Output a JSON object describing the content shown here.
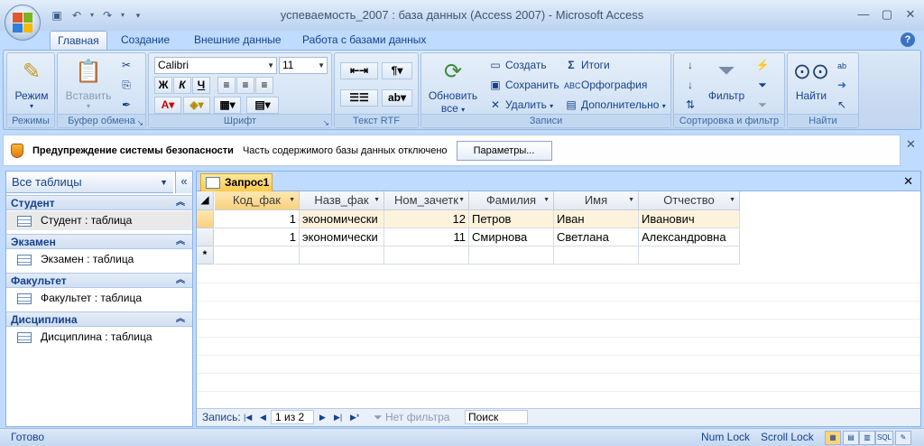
{
  "app": {
    "title": "успеваемость_2007 : база данных (Access 2007) - Microsoft Access"
  },
  "tabs": [
    "Главная",
    "Создание",
    "Внешние данные",
    "Работа с базами данных"
  ],
  "ribbon": {
    "groups": {
      "modes": "Режимы",
      "clipboard": "Буфер обмена",
      "font": "Шрифт",
      "rtf": "Текст RTF",
      "records": "Записи",
      "sort": "Сортировка и фильтр",
      "find": "Найти"
    },
    "mode_label": "Режим",
    "paste_label": "Вставить",
    "font_name": "Calibri",
    "font_size": "11",
    "refresh_label": "Обновить",
    "refresh_label2": "все",
    "create_label": "Создать",
    "save_label": "Сохранить",
    "delete_label": "Удалить",
    "totals_label": "Итоги",
    "spelling_label": "Орфография",
    "more_label": "Дополнительно",
    "filter_label": "Фильтр",
    "find_label": "Найти",
    "bold": "Ж",
    "italic": "К",
    "underline": "Ч"
  },
  "security": {
    "title": "Предупреждение системы безопасности",
    "message": "Часть содержимого базы данных отключено",
    "button": "Параметры..."
  },
  "nav": {
    "header": "Все таблицы",
    "groups": [
      {
        "name": "Студент",
        "item": "Студент : таблица"
      },
      {
        "name": "Экзамен",
        "item": "Экзамен : таблица"
      },
      {
        "name": "Факультет",
        "item": "Факультет : таблица"
      },
      {
        "name": "Дисциплина",
        "item": "Дисциплина : таблица"
      }
    ]
  },
  "document": {
    "tab": "Запрос1",
    "columns": [
      "Код_фак",
      "Назв_фак",
      "Ном_зачетк",
      "Фамилия",
      "Имя",
      "Отчество"
    ],
    "rows": [
      [
        "1",
        "экономически",
        "12",
        "Петров",
        "Иван",
        "Иванович"
      ],
      [
        "1",
        "экономически",
        "11",
        "Смирнова",
        "Светлана",
        "Александровна"
      ]
    ],
    "new_row_marker": "*"
  },
  "recordnav": {
    "label": "Запись:",
    "position": "1 из 2",
    "filter": "Нет фильтра",
    "search": "Поиск"
  },
  "status": {
    "ready": "Готово",
    "num_lock": "Num Lock",
    "scroll_lock": "Scroll Lock",
    "sql": "SQL"
  }
}
